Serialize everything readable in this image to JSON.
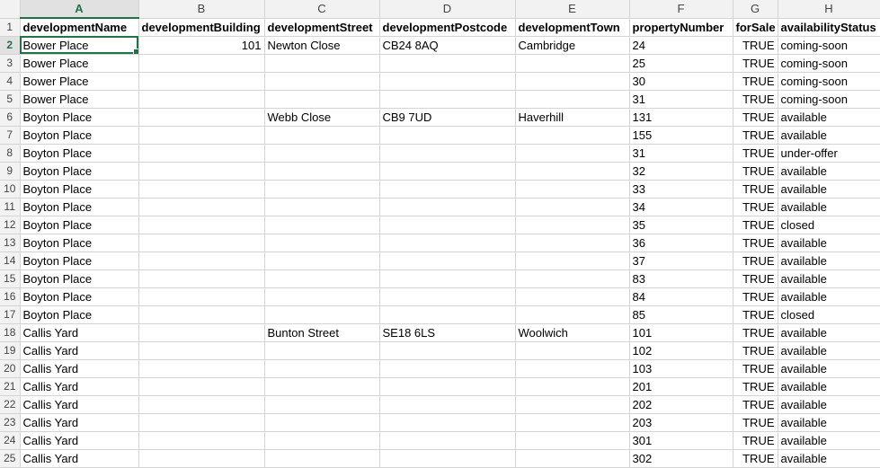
{
  "columns": [
    "A",
    "B",
    "C",
    "D",
    "E",
    "F",
    "G",
    "H"
  ],
  "active_column": "A",
  "active_row": "2",
  "rows": [
    {
      "n": "1",
      "cells": [
        "developmentName",
        "developmentBuilding",
        "developmentStreet",
        "developmentPostcode",
        "developmentTown",
        "propertyNumber",
        "forSale",
        "availabilityStatus"
      ]
    },
    {
      "n": "2",
      "cells": [
        "Bower Place",
        "101",
        "Newton Close",
        "CB24 8AQ",
        "Cambridge",
        "24",
        "TRUE",
        "coming-soon"
      ]
    },
    {
      "n": "3",
      "cells": [
        "Bower Place",
        "",
        "",
        "",
        "",
        "25",
        "TRUE",
        "coming-soon"
      ]
    },
    {
      "n": "4",
      "cells": [
        "Bower Place",
        "",
        "",
        "",
        "",
        "30",
        "TRUE",
        "coming-soon"
      ]
    },
    {
      "n": "5",
      "cells": [
        "Bower Place",
        "",
        "",
        "",
        "",
        "31",
        "TRUE",
        "coming-soon"
      ]
    },
    {
      "n": "6",
      "cells": [
        "Boyton Place",
        "",
        "Webb Close",
        "CB9 7UD",
        "Haverhill",
        "131",
        "TRUE",
        "available"
      ]
    },
    {
      "n": "7",
      "cells": [
        "Boyton Place",
        "",
        "",
        "",
        "",
        "155",
        "TRUE",
        "available"
      ]
    },
    {
      "n": "8",
      "cells": [
        "Boyton Place",
        "",
        "",
        "",
        "",
        "31",
        "TRUE",
        "under-offer"
      ]
    },
    {
      "n": "9",
      "cells": [
        "Boyton Place",
        "",
        "",
        "",
        "",
        "32",
        "TRUE",
        "available"
      ]
    },
    {
      "n": "10",
      "cells": [
        "Boyton Place",
        "",
        "",
        "",
        "",
        "33",
        "TRUE",
        "available"
      ]
    },
    {
      "n": "11",
      "cells": [
        "Boyton Place",
        "",
        "",
        "",
        "",
        "34",
        "TRUE",
        "available"
      ]
    },
    {
      "n": "12",
      "cells": [
        "Boyton Place",
        "",
        "",
        "",
        "",
        "35",
        "TRUE",
        "closed"
      ]
    },
    {
      "n": "13",
      "cells": [
        "Boyton Place",
        "",
        "",
        "",
        "",
        "36",
        "TRUE",
        "available"
      ]
    },
    {
      "n": "14",
      "cells": [
        "Boyton Place",
        "",
        "",
        "",
        "",
        "37",
        "TRUE",
        "available"
      ]
    },
    {
      "n": "15",
      "cells": [
        "Boyton Place",
        "",
        "",
        "",
        "",
        "83",
        "TRUE",
        "available"
      ]
    },
    {
      "n": "16",
      "cells": [
        "Boyton Place",
        "",
        "",
        "",
        "",
        "84",
        "TRUE",
        "available"
      ]
    },
    {
      "n": "17",
      "cells": [
        "Boyton Place",
        "",
        "",
        "",
        "",
        "85",
        "TRUE",
        "closed"
      ]
    },
    {
      "n": "18",
      "cells": [
        "Callis Yard",
        "",
        "Bunton Street",
        "SE18 6LS",
        "Woolwich",
        "101",
        "TRUE",
        "available"
      ]
    },
    {
      "n": "19",
      "cells": [
        "Callis Yard",
        "",
        "",
        "",
        "",
        "102",
        "TRUE",
        "available"
      ]
    },
    {
      "n": "20",
      "cells": [
        "Callis Yard",
        "",
        "",
        "",
        "",
        "103",
        "TRUE",
        "available"
      ]
    },
    {
      "n": "21",
      "cells": [
        "Callis Yard",
        "",
        "",
        "",
        "",
        "201",
        "TRUE",
        "available"
      ]
    },
    {
      "n": "22",
      "cells": [
        "Callis Yard",
        "",
        "",
        "",
        "",
        "202",
        "TRUE",
        "available"
      ]
    },
    {
      "n": "23",
      "cells": [
        "Callis Yard",
        "",
        "",
        "",
        "",
        "203",
        "TRUE",
        "available"
      ]
    },
    {
      "n": "24",
      "cells": [
        "Callis Yard",
        "",
        "",
        "",
        "",
        "301",
        "TRUE",
        "available"
      ]
    },
    {
      "n": "25",
      "cells": [
        "Callis Yard",
        "",
        "",
        "",
        "",
        "302",
        "TRUE",
        "available"
      ]
    }
  ]
}
